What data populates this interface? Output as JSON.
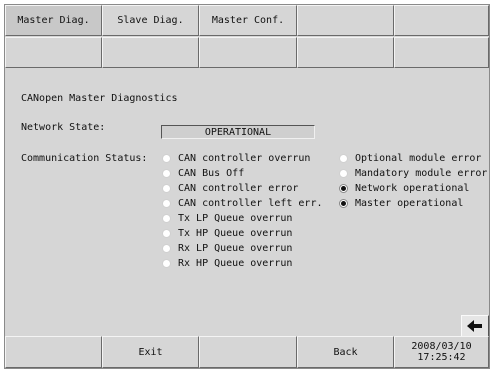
{
  "tabs": [
    {
      "label": "Master Diag."
    },
    {
      "label": "Slave Diag."
    },
    {
      "label": "Master Conf."
    },
    {
      "label": ""
    },
    {
      "label": ""
    }
  ],
  "title": "CANopen Master Diagnostics",
  "network_state": {
    "label": "Network State:",
    "value": "OPERATIONAL"
  },
  "communication_status": {
    "label": "Communication Status:",
    "left_items": [
      {
        "label": "CAN controller overrun",
        "active": false
      },
      {
        "label": "CAN Bus Off",
        "active": false
      },
      {
        "label": "CAN controller error",
        "active": false
      },
      {
        "label": "CAN controller left err.",
        "active": false
      },
      {
        "label": "Tx LP Queue overrun",
        "active": false
      },
      {
        "label": "Tx HP Queue overrun",
        "active": false
      },
      {
        "label": "Rx LP Queue overrun",
        "active": false
      },
      {
        "label": "Rx HP Queue overrun",
        "active": false
      }
    ],
    "right_items": [
      {
        "label": "Optional module error",
        "active": false
      },
      {
        "label": "Mandatory module error",
        "active": false
      },
      {
        "label": "Network operational",
        "active": true
      },
      {
        "label": "Master operational",
        "active": true
      }
    ]
  },
  "bottom_bar": {
    "exit_label": "Exit",
    "back_label": "Back",
    "date": "2008/03/10",
    "time": "17:25:42"
  },
  "icons": {
    "back_arrow": "left-arrow-icon"
  }
}
